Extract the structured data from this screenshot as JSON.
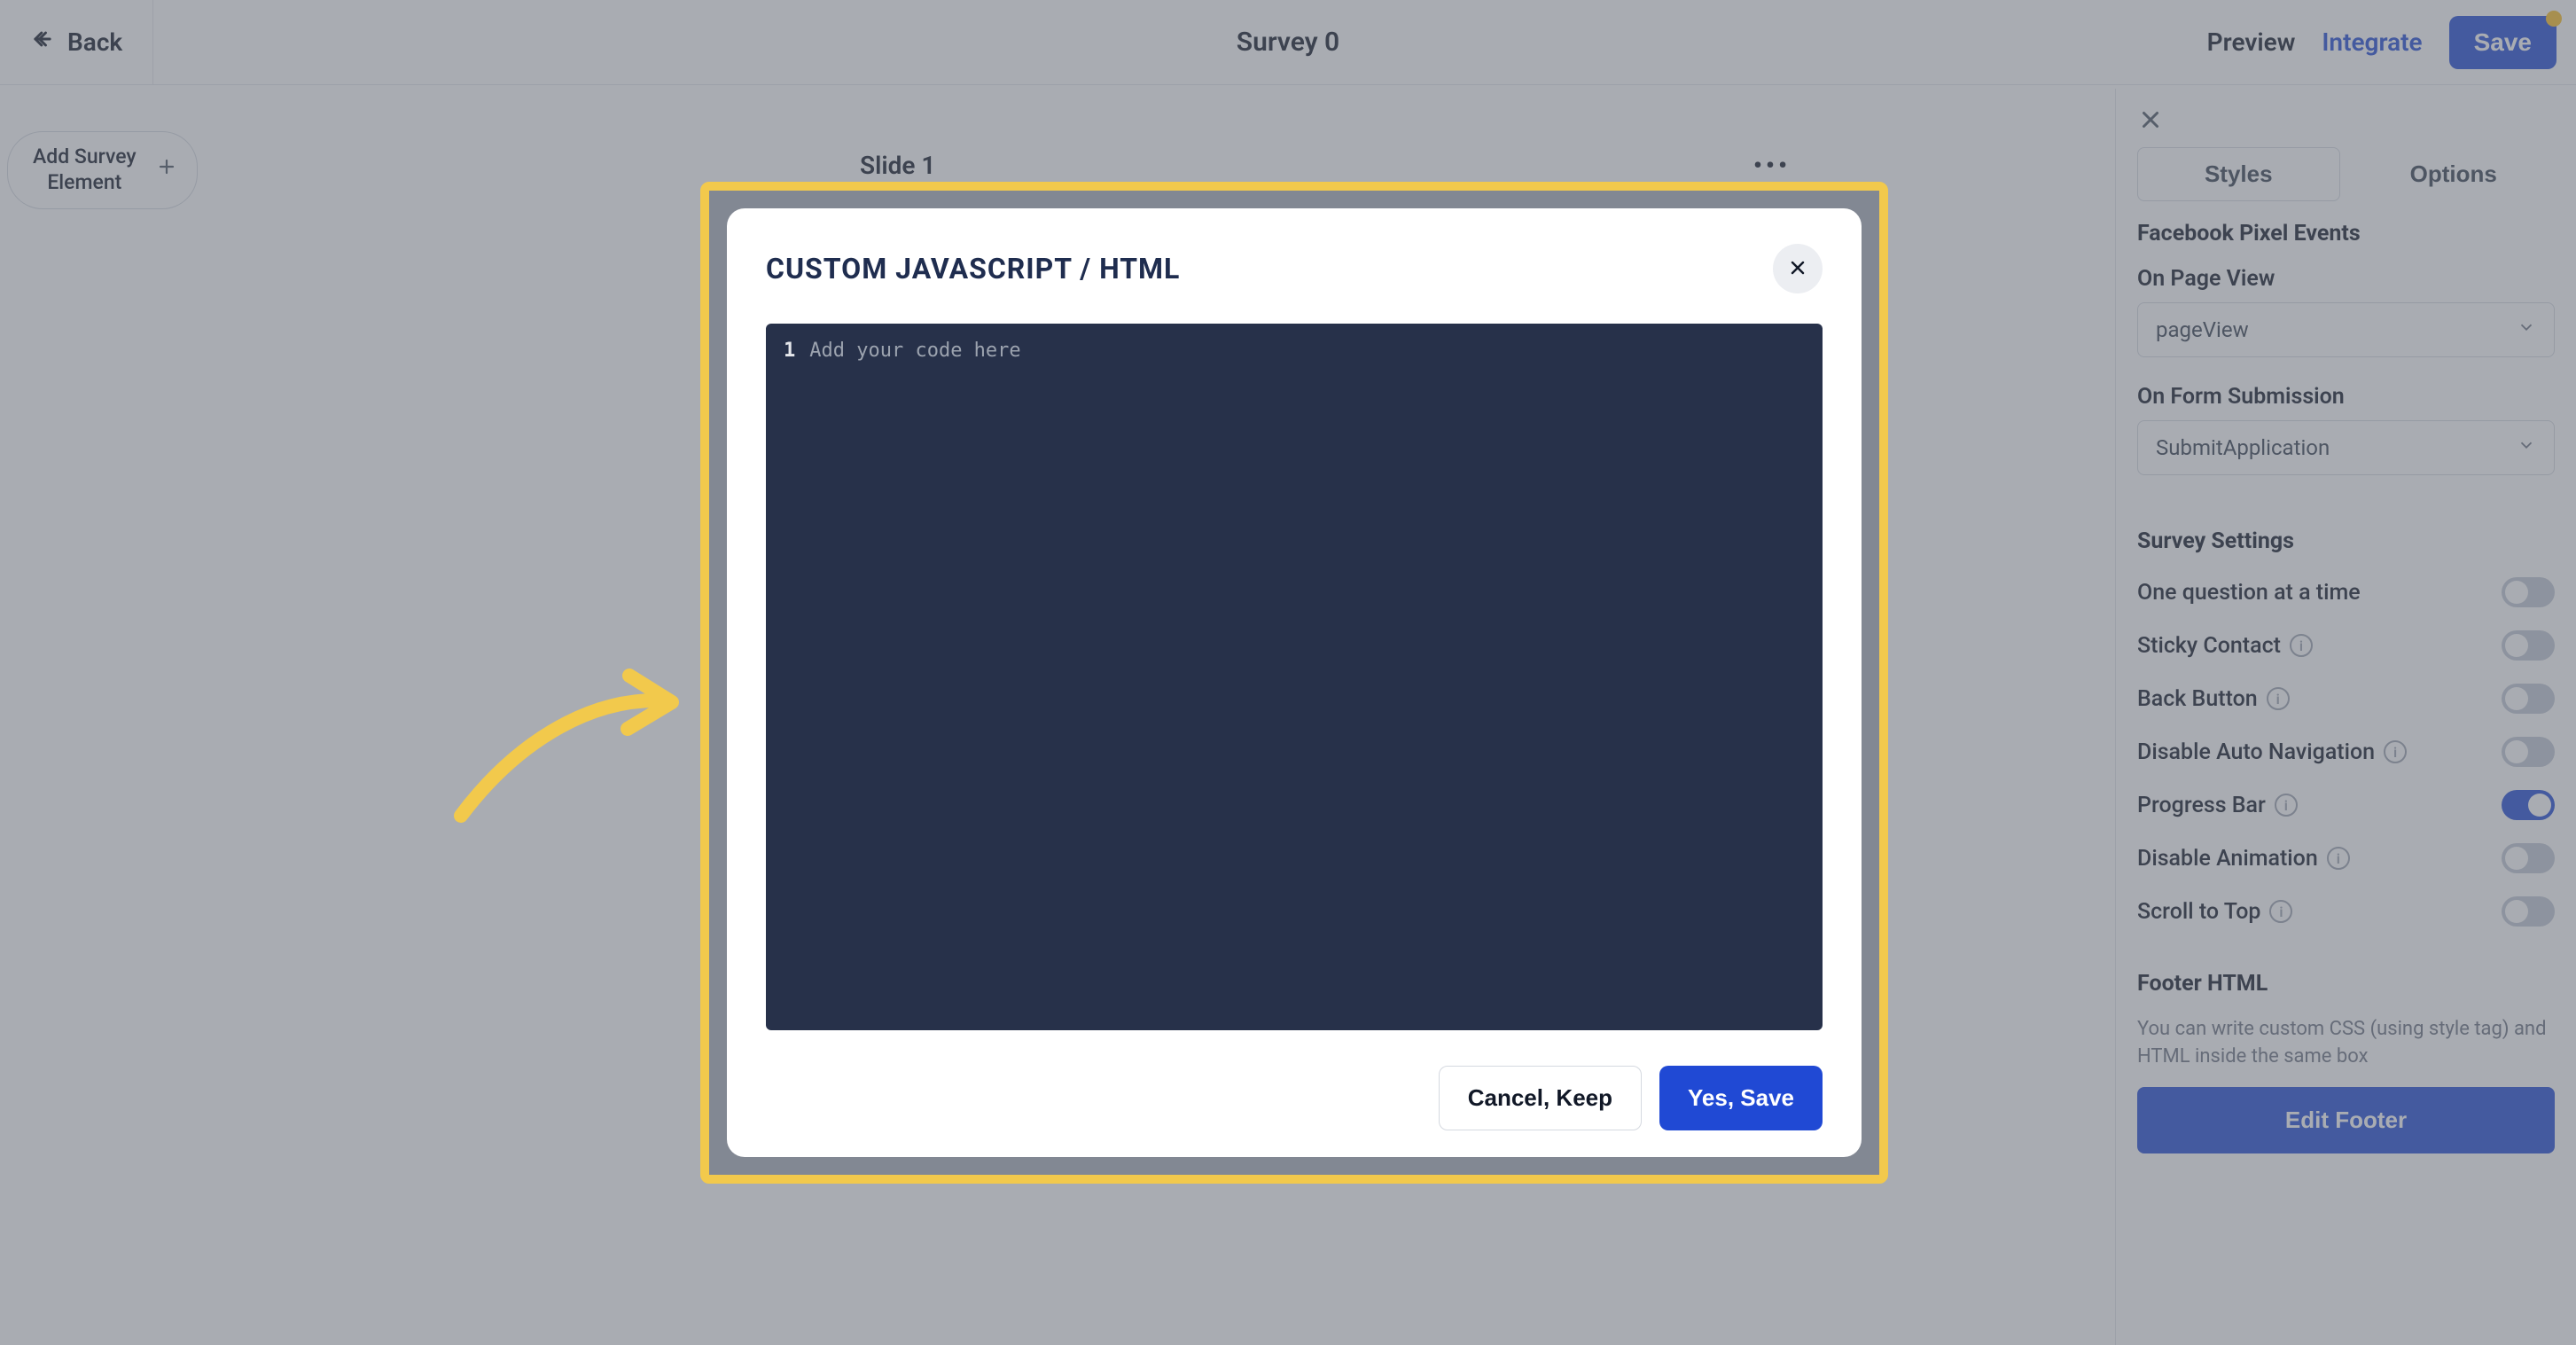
{
  "header": {
    "back_label": "Back",
    "title": "Survey 0",
    "preview_label": "Preview",
    "integrate_label": "Integrate",
    "save_label": "Save"
  },
  "left_pill": {
    "label": "Add Survey\nElement"
  },
  "slide": {
    "title": "Slide 1"
  },
  "modal": {
    "title": "CUSTOM JAVASCRIPT / HTML",
    "editor": {
      "line_number": "1",
      "placeholder": "Add your code here"
    },
    "cancel_label": "Cancel, Keep",
    "save_label": "Yes, Save"
  },
  "panel": {
    "tabs": {
      "styles": "Styles",
      "options": "Options"
    },
    "fb_section_title": "Facebook Pixel Events",
    "on_page_view_label": "On Page View",
    "on_page_view_value": "pageView",
    "on_form_sub_label": "On Form Submission",
    "on_form_sub_value": "SubmitApplication",
    "survey_settings_title": "Survey Settings",
    "toggles": {
      "one_question": {
        "label": "One question at a time",
        "on": false
      },
      "sticky_contact": {
        "label": "Sticky Contact",
        "on": false,
        "info": true
      },
      "back_button": {
        "label": "Back Button",
        "on": false,
        "info": true
      },
      "disable_auto_nav": {
        "label": "Disable Auto Navigation",
        "on": false,
        "info": true
      },
      "progress_bar": {
        "label": "Progress Bar",
        "on": true,
        "info": true
      },
      "disable_animation": {
        "label": "Disable Animation",
        "on": false,
        "info": true
      },
      "scroll_to_top": {
        "label": "Scroll to Top",
        "on": false,
        "info": true
      }
    },
    "footer_title": "Footer HTML",
    "footer_note": "You can write custom CSS (using style tag) and HTML inside the same box",
    "edit_footer_label": "Edit Footer"
  },
  "colors": {
    "accent": "#2049d4",
    "highlight": "#f2c94c"
  }
}
